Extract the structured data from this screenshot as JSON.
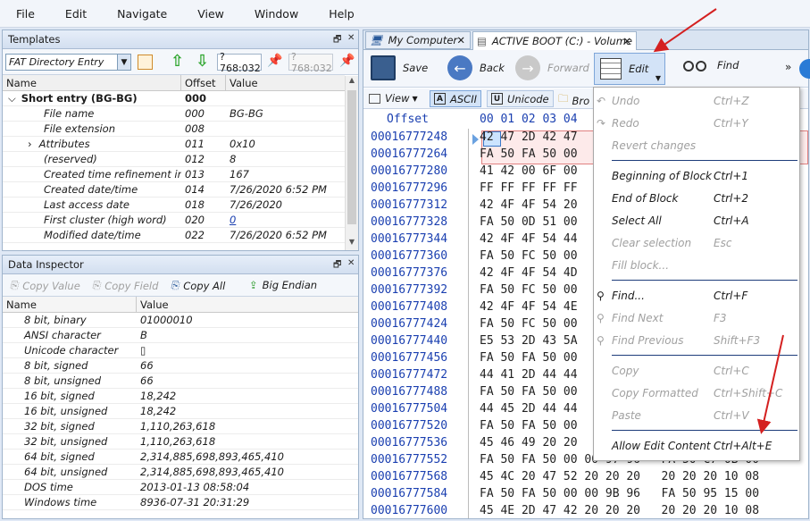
{
  "menubar": {
    "items": [
      "File",
      "Edit",
      "Navigate",
      "View",
      "Window",
      "Help"
    ]
  },
  "templates": {
    "title": "Templates",
    "template_select": "FAT Directory Entry",
    "offset_value": "?768:032",
    "offset_value2": "?768:032",
    "columns": [
      "Name",
      "Offset",
      "Value"
    ],
    "rows": [
      {
        "name": "Short entry (BG-BG)",
        "offset": "000",
        "value": ""
      },
      {
        "name": "File name",
        "offset": "000",
        "value": "BG-BG"
      },
      {
        "name": "File extension",
        "offset": "008",
        "value": ""
      },
      {
        "name": "Attributes",
        "offset": "011",
        "value": "0x10"
      },
      {
        "name": "(reserved)",
        "offset": "012",
        "value": "8"
      },
      {
        "name": "Created time refinement in ...",
        "offset": "013",
        "value": "167"
      },
      {
        "name": "Created date/time",
        "offset": "014",
        "value": "7/26/2020 6:52 PM"
      },
      {
        "name": "Last access date",
        "offset": "018",
        "value": "7/26/2020"
      },
      {
        "name": "First cluster (high word)",
        "offset": "020",
        "value": "0"
      },
      {
        "name": "Modified date/time",
        "offset": "022",
        "value": "7/26/2020 6:52 PM"
      }
    ]
  },
  "inspector": {
    "title": "Data Inspector",
    "buttons": [
      "Copy Value",
      "Copy Field",
      "Copy All",
      "Big Endian"
    ],
    "columns": [
      "Name",
      "Value"
    ],
    "rows": [
      {
        "name": "8 bit, binary",
        "value": "01000010"
      },
      {
        "name": "ANSI character",
        "value": "B"
      },
      {
        "name": "Unicode character",
        "value": "▯"
      },
      {
        "name": "8 bit, signed",
        "value": "66"
      },
      {
        "name": "8 bit, unsigned",
        "value": "66"
      },
      {
        "name": "16 bit, signed",
        "value": "18,242"
      },
      {
        "name": "16 bit, unsigned",
        "value": "18,242"
      },
      {
        "name": "32 bit, signed",
        "value": "1,110,263,618"
      },
      {
        "name": "32 bit, unsigned",
        "value": "1,110,263,618"
      },
      {
        "name": "64 bit, signed",
        "value": "2,314,885,698,893,465,410"
      },
      {
        "name": "64 bit, unsigned",
        "value": "2,314,885,698,893,465,410"
      },
      {
        "name": "DOS time",
        "value": "2013-01-13 08:58:04"
      },
      {
        "name": "Windows time",
        "value": "8936-07-31 20:31:29"
      }
    ]
  },
  "tabs": [
    {
      "label": "My Computer"
    },
    {
      "label": "ACTIVE BOOT (C:) - Volume"
    }
  ],
  "editor_toolbar": {
    "save": "Save",
    "back": "Back",
    "forward": "Forward",
    "edit": "Edit",
    "find": "Find",
    "more": "»"
  },
  "view_toolbar": {
    "view": "View",
    "ascii": "ASCII",
    "unicode": "Unicode",
    "bro": "Bro"
  },
  "hex": {
    "offset_header": "Offset",
    "col_header": "00 01 02 03 04",
    "rows": [
      {
        "offset": "00016777248",
        "bytes": "42 47 2D 42 47"
      },
      {
        "offset": "00016777264",
        "bytes": "FA 50 FA 50 00"
      },
      {
        "offset": "00016777280",
        "bytes": "41 42 00 6F 00"
      },
      {
        "offset": "00016777296",
        "bytes": "FF FF FF FF FF"
      },
      {
        "offset": "00016777312",
        "bytes": "42 4F 4F 54 20"
      },
      {
        "offset": "00016777328",
        "bytes": "FA 50 0D 51 00"
      },
      {
        "offset": "00016777344",
        "bytes": "42 4F 4F 54 44"
      },
      {
        "offset": "00016777360",
        "bytes": "FA 50 FC 50 00"
      },
      {
        "offset": "00016777376",
        "bytes": "42 4F 4F 54 4D"
      },
      {
        "offset": "00016777392",
        "bytes": "FA 50 FC 50 00"
      },
      {
        "offset": "00016777408",
        "bytes": "42 4F 4F 54 4E"
      },
      {
        "offset": "00016777424",
        "bytes": "FA 50 FC 50 00"
      },
      {
        "offset": "00016777440",
        "bytes": "E5 53 2D 43 5A"
      },
      {
        "offset": "00016777456",
        "bytes": "FA 50 FA 50 00"
      },
      {
        "offset": "00016777472",
        "bytes": "44 41 2D 44 44"
      },
      {
        "offset": "00016777488",
        "bytes": "FA 50 FA 50 00"
      },
      {
        "offset": "00016777504",
        "bytes": "44 45 2D 44 44"
      },
      {
        "offset": "00016777520",
        "bytes": "FA 50 FA 50 00"
      },
      {
        "offset": "00016777536",
        "bytes": "45 46 49 20 20"
      },
      {
        "offset": "00016777552",
        "bytes": "FA 50 FA 50 00 00 97 96   FA 50 C7 0B 00"
      },
      {
        "offset": "00016777568",
        "bytes": "45 4C 20 47 52 20 20 20   20 20 20 10 08"
      },
      {
        "offset": "00016777584",
        "bytes": "FA 50 FA 50 00 00 9B 96   FA 50 95 15 00"
      },
      {
        "offset": "00016777600",
        "bytes": "45 4E 2D 47 42 20 20 20   20 20 20 10 08"
      }
    ]
  },
  "edit_menu": {
    "items": [
      {
        "label": "Undo",
        "key": "Ctrl+Z",
        "disabled": true
      },
      {
        "label": "Redo",
        "key": "Ctrl+Y",
        "disabled": true
      },
      {
        "label": "Revert changes",
        "key": "",
        "disabled": true
      },
      {
        "label": "Beginning of Block",
        "key": "Ctrl+1",
        "disabled": false
      },
      {
        "label": "End of Block",
        "key": "Ctrl+2",
        "disabled": false
      },
      {
        "label": "Select All",
        "key": "Ctrl+A",
        "disabled": false
      },
      {
        "label": "Clear selection",
        "key": "Esc",
        "disabled": true
      },
      {
        "label": "Fill block...",
        "key": "",
        "disabled": true
      },
      {
        "label": "Find...",
        "key": "Ctrl+F",
        "disabled": false
      },
      {
        "label": "Find Next",
        "key": "F3",
        "disabled": true
      },
      {
        "label": "Find Previous",
        "key": "Shift+F3",
        "disabled": true
      },
      {
        "label": "Copy",
        "key": "Ctrl+C",
        "disabled": true
      },
      {
        "label": "Copy Formatted",
        "key": "Ctrl+Shift+C",
        "disabled": true
      },
      {
        "label": "Paste",
        "key": "Ctrl+V",
        "disabled": true
      },
      {
        "label": "Allow Edit Content",
        "key": "Ctrl+Alt+E",
        "disabled": false
      }
    ]
  },
  "colors": {
    "accent": "#1a3fb0",
    "arrow": "#d42020",
    "selection": "#cce4ff"
  }
}
